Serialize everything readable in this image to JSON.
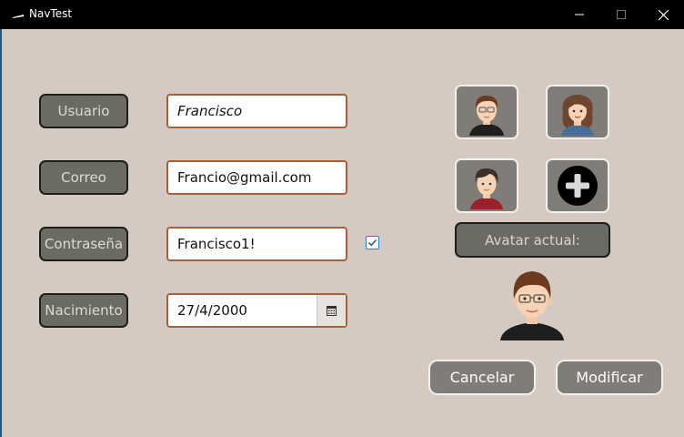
{
  "window": {
    "title": "NavTest"
  },
  "form": {
    "username_label": "Usuario",
    "username_value": "Francisco",
    "email_label": "Correo",
    "email_value": "Francio@gmail.com",
    "password_label": "Contraseña",
    "password_value": "Francisco1!",
    "show_password_checked": true,
    "birth_label": "Nacimiento",
    "birth_value": "27/4/2000"
  },
  "avatars": {
    "options": [
      "avatar-male-glasses",
      "avatar-female",
      "avatar-male-red",
      "add-avatar"
    ],
    "current_label": "Avatar actual:",
    "current": "avatar-male-glasses"
  },
  "actions": {
    "cancel_label": "Cancelar",
    "modify_label": "Modificar"
  },
  "colors": {
    "background": "#d4cac1",
    "label_bg": "#6b6a63",
    "button_bg": "#807c77",
    "field_border": "#a6603a",
    "checkbox_accent": "#2e7fb8"
  }
}
